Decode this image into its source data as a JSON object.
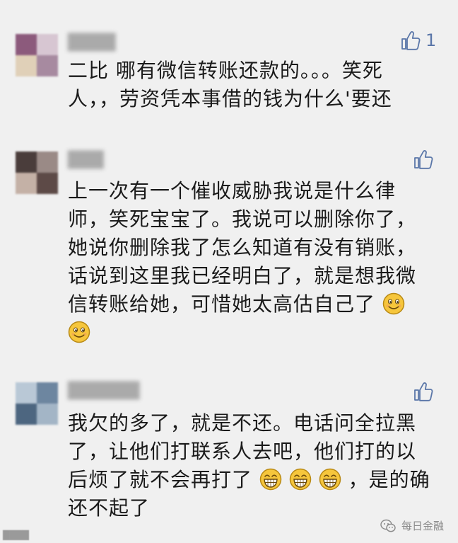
{
  "comments": [
    {
      "author": "████",
      "likes": "1",
      "lines": [
        "二比  哪有微信转账还款的。。。笑死",
        "人，，劳资凭本事借的钱为什么'要还"
      ]
    },
    {
      "author": "███",
      "likes": "",
      "lines": [
        "上一次有一个催收威胁我说是什么律",
        "师，笑死宝宝了。我说可以删除你了，",
        "她说你删除我了怎么知道有没有销账，",
        "话说到这里我已经明白了，就是想我微",
        "信转账给她，可惜她太高估自己了"
      ]
    },
    {
      "author": "██████",
      "likes": "",
      "lines": [
        "我欠的多了，就是不还。电话问全拉黑",
        "了，让他们打联系人去吧，他们打的以",
        "后烦了就不会再打了",
        "，是的确",
        "还不起了"
      ]
    }
  ],
  "icons": {
    "like": "thumbs-up-icon",
    "smile": "smile-emoji",
    "grin": "grin-emoji"
  },
  "watermark_left": "████",
  "brand_name": "每日金融",
  "colors": {
    "background": "#f0f0f0",
    "text": "#1a1a1a",
    "like_blue": "#5a76a8",
    "emoji_yellow": "#f6c63c"
  }
}
